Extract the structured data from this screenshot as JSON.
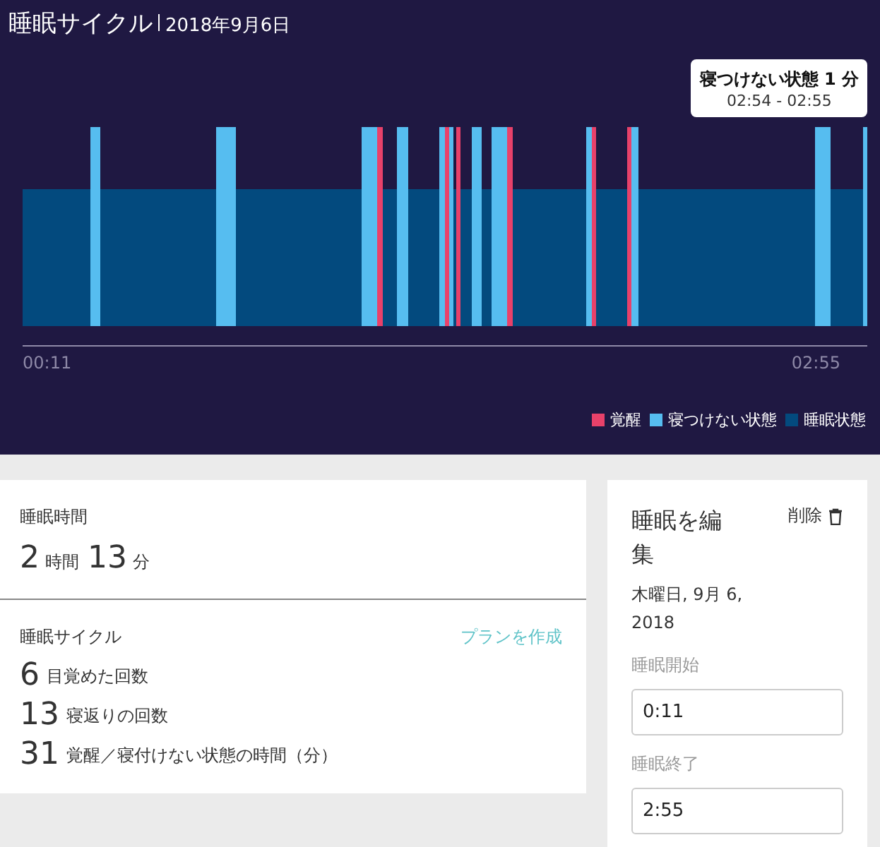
{
  "header": {
    "title": "睡眠サイクル",
    "date": "2018年9月6日"
  },
  "chart": {
    "start_label": "00:11",
    "end_label": "02:55",
    "tooltip": {
      "title": "寝つけない状態 1 分",
      "range": "02:54 - 02:55"
    }
  },
  "legend": [
    {
      "label": "覚醒",
      "color": "#e8416a"
    },
    {
      "label": "寝つけない状態",
      "color": "#56bdf0"
    },
    {
      "label": "睡眠状態",
      "color": "#034a7e"
    }
  ],
  "duration": {
    "label": "睡眠時間",
    "parts": [
      {
        "value": "2",
        "unit": "時間"
      },
      {
        "value": "13",
        "unit": "分"
      }
    ]
  },
  "cycle": {
    "label": "睡眠サイクル",
    "link": "プランを作成",
    "stats": [
      {
        "count": "6",
        "description": "目覚めた回数"
      },
      {
        "count": "13",
        "description": "寝返りの回数"
      },
      {
        "count": "31",
        "description": "覚醒／寝付けない状態の時間（分）"
      }
    ]
  },
  "edit": {
    "title": "睡眠を編集",
    "delete": "削除",
    "date": "木曜日, 9月 6, 2018",
    "fields": [
      {
        "label": "睡眠開始",
        "value": "0:11"
      },
      {
        "label": "睡眠終了",
        "value": "2:55"
      }
    ]
  }
}
